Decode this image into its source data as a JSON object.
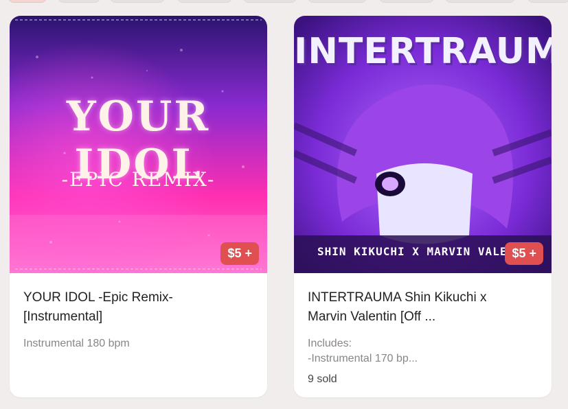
{
  "products": [
    {
      "cover_title": "YOUR IDOL",
      "cover_subtitle": "-EPIC REMIX-",
      "price": "$5 +",
      "title_line1": "YOUR IDOL -Epic Remix-",
      "title_line2": "[Instrumental]",
      "description": "Instrumental 180 bpm"
    },
    {
      "cover_title": "INTERTRAUMA",
      "cover_subtitle": "SHIN KIKUCHI X MARVIN VALE",
      "price": "$5 +",
      "title_line1": "INTERTRAUMA Shin Kikuchi x",
      "title_line2": "Marvin Valentin [Off ...",
      "description_line1": "Includes:",
      "description_line2": "-Instrumental 170 bp...",
      "sold": "9 sold"
    }
  ],
  "colors": {
    "page_bg": "#f2eded",
    "badge_bg": "#e05050",
    "cover1_top": "#3a1a8c",
    "cover1_bottom": "#ff2fb0",
    "cover2_bg": "#7a2bd6"
  }
}
